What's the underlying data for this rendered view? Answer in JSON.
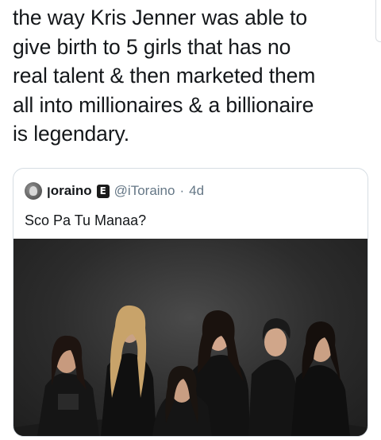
{
  "tweet": {
    "text_lines": [
      "the way Kris Jenner was able to",
      "give birth to 5 girls that has no",
      "real talent & then marketed them",
      "all into millionaires & a billionaire",
      "is legendary."
    ]
  },
  "quoted_tweet": {
    "display_name": "ꞁoraino",
    "badge": "E",
    "handle": "@iToraino",
    "separator": "·",
    "age": "4d",
    "text": "Sco Pa Tu Manaa?"
  },
  "icons": {
    "avatar": "user-avatar-icon",
    "badge": "verified-badge-icon"
  },
  "colors": {
    "text": "#14171a",
    "secondary_text": "#657786",
    "card_border": "#d6dde3",
    "photo_background": "#2c2c2c"
  }
}
